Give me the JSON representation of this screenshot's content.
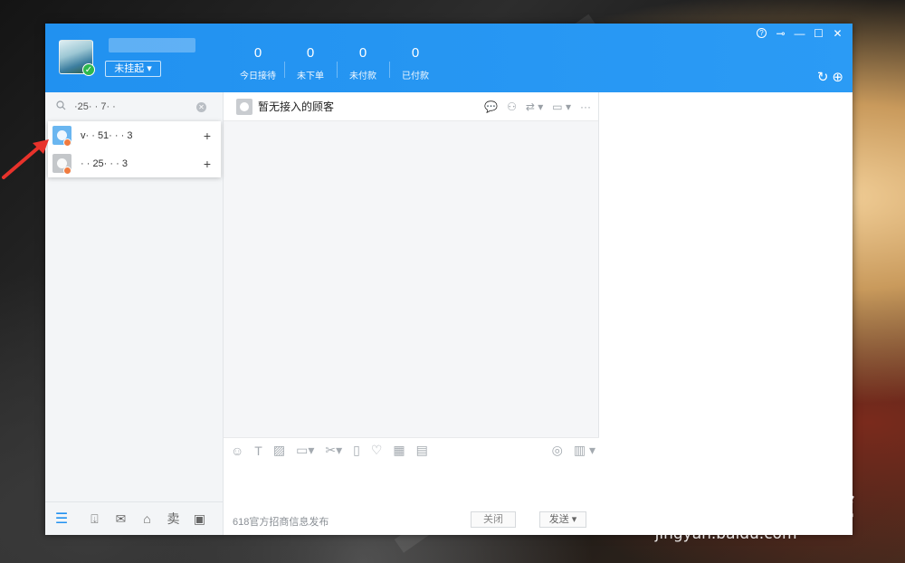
{
  "user": {
    "status": "未挂起 ▾"
  },
  "stats": [
    {
      "value": "0",
      "label": "今日接待"
    },
    {
      "value": "0",
      "label": "未下单"
    },
    {
      "value": "0",
      "label": "未付款"
    },
    {
      "value": "0",
      "label": "已付款"
    }
  ],
  "window_controls": {
    "help": "?",
    "pin": "⊸",
    "minimize": "—",
    "maximize": "☐",
    "close": "✕"
  },
  "title_tools": {
    "refresh": "↻",
    "add": "⊕"
  },
  "search": {
    "value": "·25· · 7· ·"
  },
  "results": [
    {
      "text": "v· · 51· · · 3",
      "add": "+"
    },
    {
      "text": "· · 25· · · 3",
      "add": "+"
    }
  ],
  "chat": {
    "title": "暂无接入的顾客"
  },
  "input": {
    "promo": "618官方招商信息发布",
    "close": "关闭",
    "send": "发送 ▾"
  },
  "footer_icons": {
    "sell": "卖"
  },
  "watermark": {
    "brand": "Bai du 经验",
    "url": "jingyan.baidu.com"
  }
}
